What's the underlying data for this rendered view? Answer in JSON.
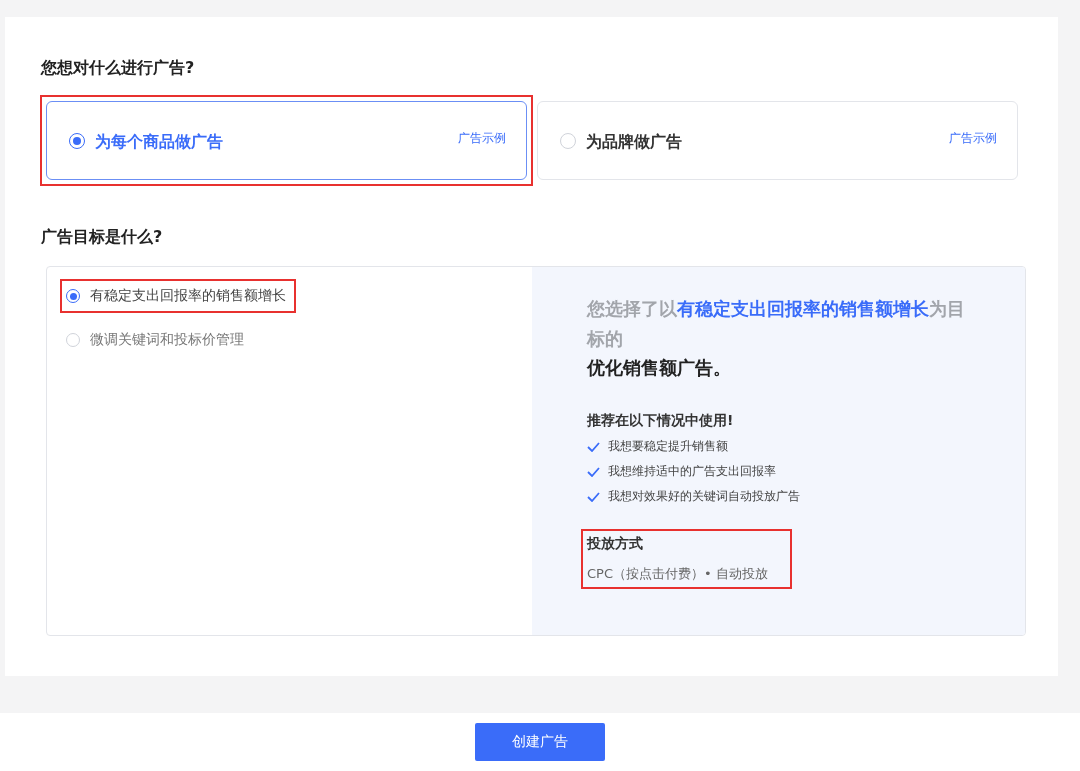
{
  "ad_target": {
    "heading": "您想对什么进行广告?",
    "options": [
      {
        "label": "为每个商品做广告",
        "link": "广告示例",
        "selected": true,
        "highlighted": true
      },
      {
        "label": "为品牌做广告",
        "link": "广告示例",
        "selected": false,
        "highlighted": false
      }
    ]
  },
  "goal": {
    "heading": "广告目标是什么?",
    "options": [
      {
        "label": "有稳定支出回报率的销售额增长",
        "selected": true,
        "highlighted": true
      },
      {
        "label": "微调关键词和投标价管理",
        "selected": false,
        "highlighted": false
      }
    ],
    "summary": {
      "intro": "您选择了以**有稳定支出回报率的销售额增长**为目标的",
      "title": "优化销售额广告。",
      "recommend_heading": "推荐在以下情况中使用!",
      "recommendations": [
        "我想要稳定提升销售额",
        "我想维持适中的广告支出回报率",
        "我想对效果好的关键词自动投放广告"
      ],
      "delivery": {
        "heading": "投放方式",
        "value": "CPC（按点击付费）• 自动投放",
        "highlighted": true
      }
    }
  },
  "create_button": "创建广告"
}
